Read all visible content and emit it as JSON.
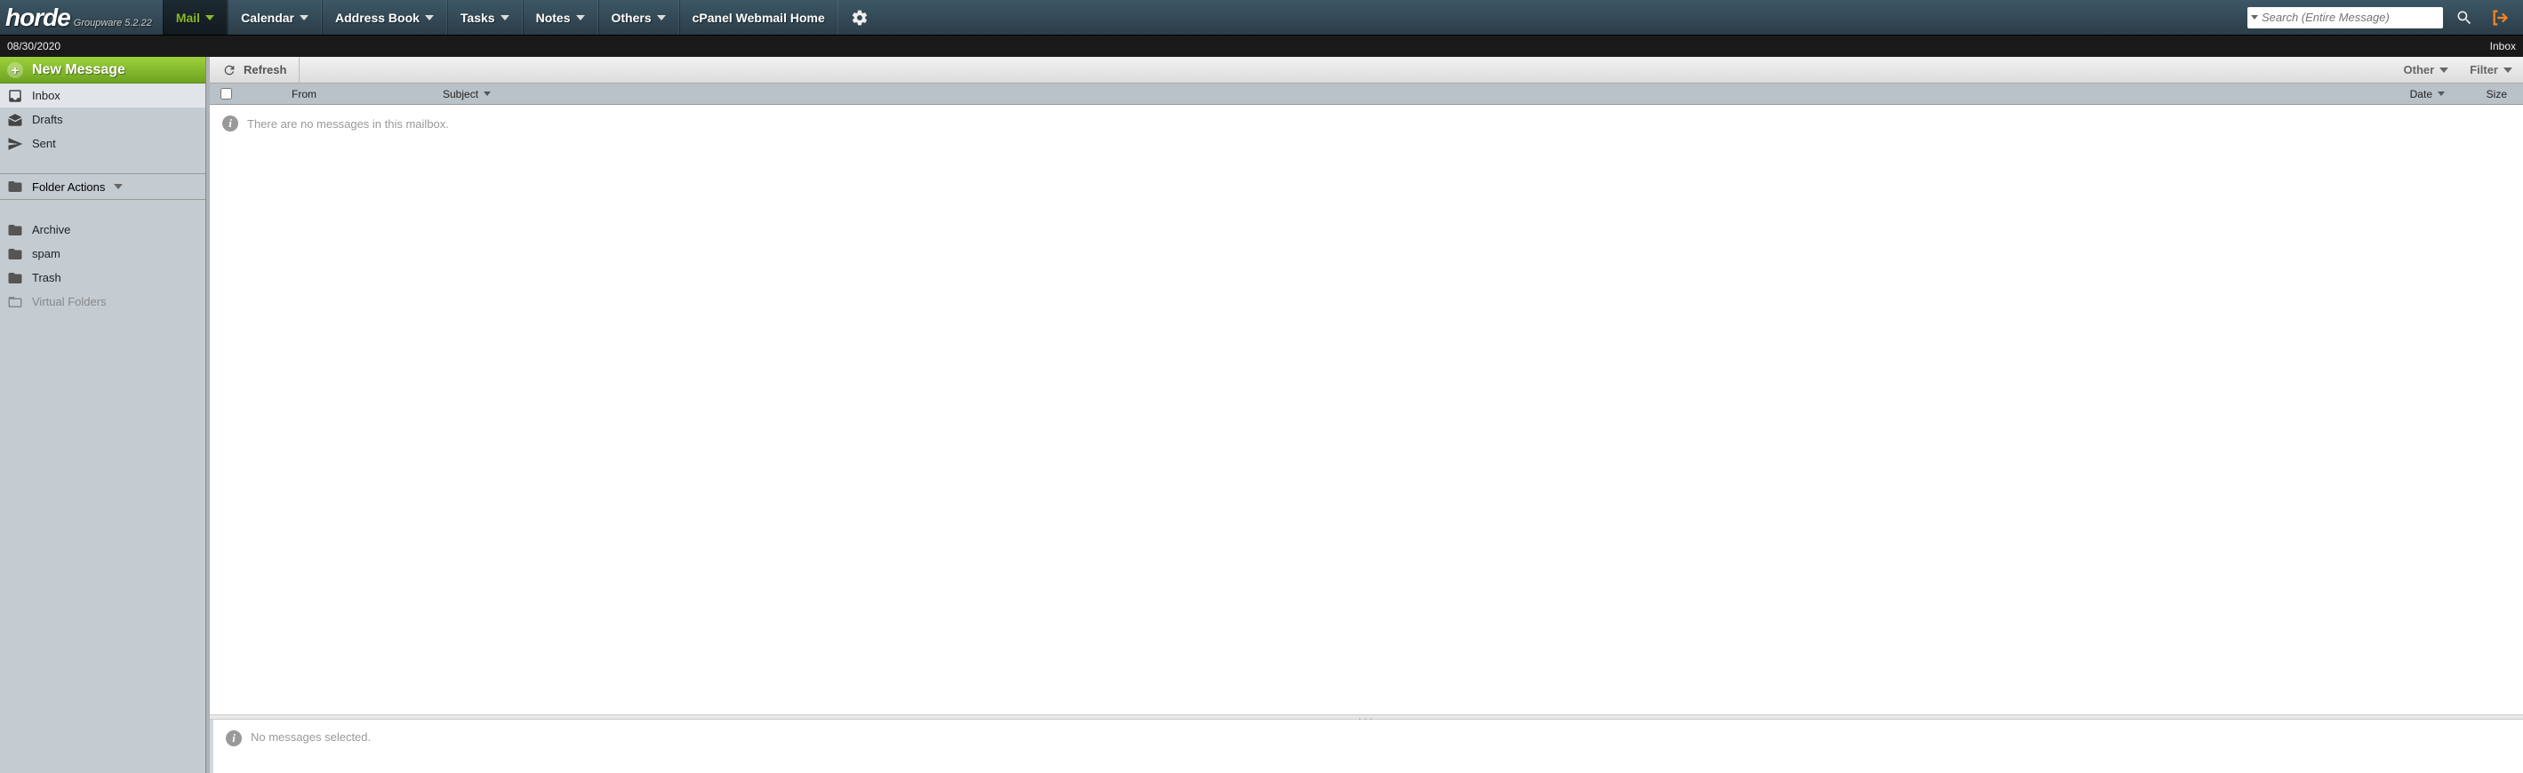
{
  "logo": {
    "main": "horde",
    "sub": "Groupware 5.2.22"
  },
  "nav": [
    {
      "label": "Mail",
      "active": true,
      "dropdown": true
    },
    {
      "label": "Calendar",
      "active": false,
      "dropdown": true
    },
    {
      "label": "Address Book",
      "active": false,
      "dropdown": true
    },
    {
      "label": "Tasks",
      "active": false,
      "dropdown": true
    },
    {
      "label": "Notes",
      "active": false,
      "dropdown": true
    },
    {
      "label": "Others",
      "active": false,
      "dropdown": true
    },
    {
      "label": "cPanel Webmail Home",
      "active": false,
      "dropdown": false
    }
  ],
  "search": {
    "placeholder": "Search (Entire Message)"
  },
  "datebar": {
    "date": "08/30/2020",
    "mailbox": "Inbox"
  },
  "sidebar": {
    "new_message": "New Message",
    "folders_primary": [
      {
        "label": "Inbox",
        "icon": "inbox",
        "selected": true
      },
      {
        "label": "Drafts",
        "icon": "drafts",
        "selected": false
      },
      {
        "label": "Sent",
        "icon": "sent",
        "selected": false
      }
    ],
    "folder_actions_label": "Folder Actions",
    "folders_secondary": [
      {
        "label": "Archive",
        "icon": "folder",
        "dim": false
      },
      {
        "label": "spam",
        "icon": "folder",
        "dim": false
      },
      {
        "label": "Trash",
        "icon": "folder",
        "dim": false
      },
      {
        "label": "Virtual Folders",
        "icon": "folder-open",
        "dim": true
      }
    ]
  },
  "toolbar": {
    "refresh": "Refresh",
    "other": "Other",
    "filter": "Filter"
  },
  "columns": {
    "from": "From",
    "subject": "Subject",
    "date": "Date",
    "size": "Size"
  },
  "messages": {
    "empty": "There are no messages in this mailbox."
  },
  "preview": {
    "none_selected": "No messages selected."
  }
}
